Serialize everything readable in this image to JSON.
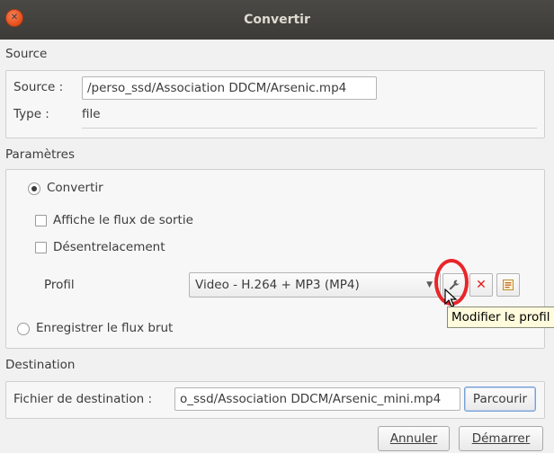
{
  "window": {
    "title": "Convertir"
  },
  "source": {
    "section_label": "Source",
    "source_label": "Source :",
    "source_value": "/perso_ssd/Association DDCM/Arsenic.mp4",
    "type_label": "Type :",
    "type_value": "file"
  },
  "parameters": {
    "section_label": "Paramètres",
    "convert_label": "Convertir",
    "convert_selected": true,
    "show_output_label": "Affiche le flux de sortie",
    "deinterlace_label": "Désentrelacement",
    "profile_label": "Profil",
    "profile_value": "Video - H.264 + MP3 (MP4)",
    "edit_profile_icon": "wrench-icon",
    "delete_profile_icon": "red-x-icon",
    "new_profile_icon": "list-icon",
    "raw_dump_label": "Enregistrer le flux brut"
  },
  "tooltip": {
    "text": "Modifier le profil"
  },
  "destination": {
    "section_label": "Destination",
    "file_label": "Fichier de destination :",
    "file_value": "o_ssd/Association DDCM/Arsenic_mini.mp4",
    "browse_label": "Parcourir"
  },
  "footer": {
    "cancel_label": "Annuler",
    "start_label": "Démarrer"
  },
  "colors": {
    "accent_close": "#e95420",
    "highlight": "#e8262a",
    "titlebar": "#3c3b37"
  }
}
